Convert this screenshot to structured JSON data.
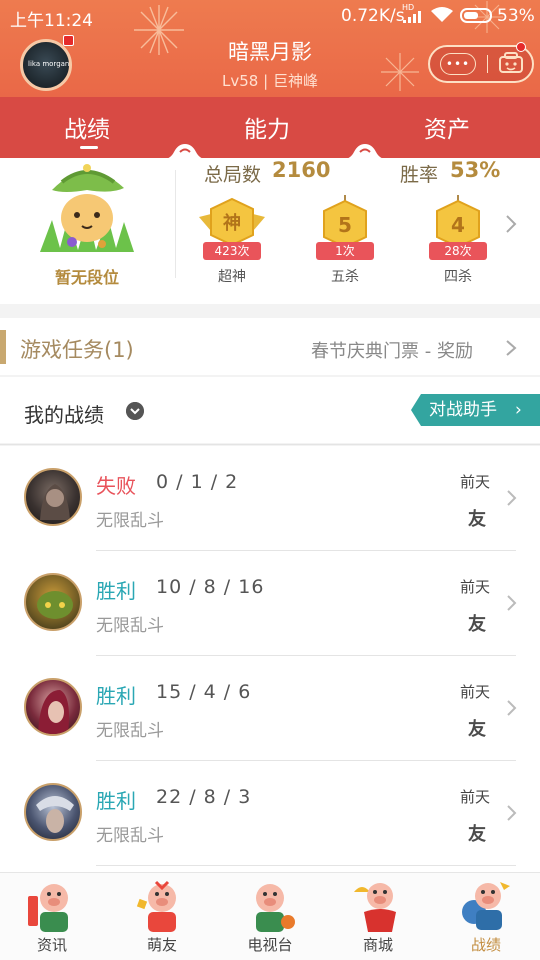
{
  "status_bar": {
    "time": "上午11:24",
    "network_speed": "0.72K/s",
    "network_type": "HD",
    "battery": "53%"
  },
  "header": {
    "avatar_text": "lika morgan",
    "player_name": "暗黑月影",
    "level": "Lv58",
    "separator": "|",
    "rank_title": "巨神峰",
    "more_dots": "•••"
  },
  "tabs": [
    {
      "label": "战绩",
      "active": true
    },
    {
      "label": "能力",
      "active": false
    },
    {
      "label": "资产",
      "active": false
    }
  ],
  "stats": {
    "rank_label": "暂无段位",
    "total_games_label": "总局数",
    "total_games": "2160",
    "win_rate_label": "胜率",
    "win_rate": "53%",
    "badges": [
      {
        "icon_text": "神",
        "count": "423次",
        "label": "超神"
      },
      {
        "icon_text": "5",
        "count": "1次",
        "label": "五杀"
      },
      {
        "icon_text": "4",
        "count": "28次",
        "label": "四杀"
      }
    ]
  },
  "mission": {
    "title": "游戏任务(1)",
    "link": "春节庆典门票 - 奖励"
  },
  "records": {
    "title": "我的战绩",
    "assistant": "对战助手"
  },
  "matches": [
    {
      "result": "失败",
      "result_color": "#e8525a",
      "kda": "0 / 1 / 2",
      "mode": "无限乱斗",
      "time": "前天",
      "tag": "友"
    },
    {
      "result": "胜利",
      "result_color": "#2aa7b4",
      "kda": "10 / 8 / 16",
      "mode": "无限乱斗",
      "time": "前天",
      "tag": "友"
    },
    {
      "result": "胜利",
      "result_color": "#2aa7b4",
      "kda": "15 / 4 / 6",
      "mode": "无限乱斗",
      "time": "前天",
      "tag": "友"
    },
    {
      "result": "胜利",
      "result_color": "#2aa7b4",
      "kda": "22 / 8 / 3",
      "mode": "无限乱斗",
      "time": "前天",
      "tag": "友"
    }
  ],
  "bottom_nav": [
    {
      "label": "资讯",
      "active": false
    },
    {
      "label": "萌友",
      "active": false
    },
    {
      "label": "电视台",
      "active": false
    },
    {
      "label": "商城",
      "active": false
    },
    {
      "label": "战绩",
      "active": true
    }
  ],
  "colors": {
    "header": "#ea6a48",
    "tab_band": "#d84a44",
    "gold_text": "#b48b3e",
    "teal": "#33a5a0",
    "active_nav": "#c28c3e"
  },
  "icons": [
    "signal-icon",
    "wifi-icon",
    "battery-icon",
    "chat-icon",
    "chevron-right-icon",
    "info-toggle-icon",
    "pig-mascot-icon"
  ]
}
